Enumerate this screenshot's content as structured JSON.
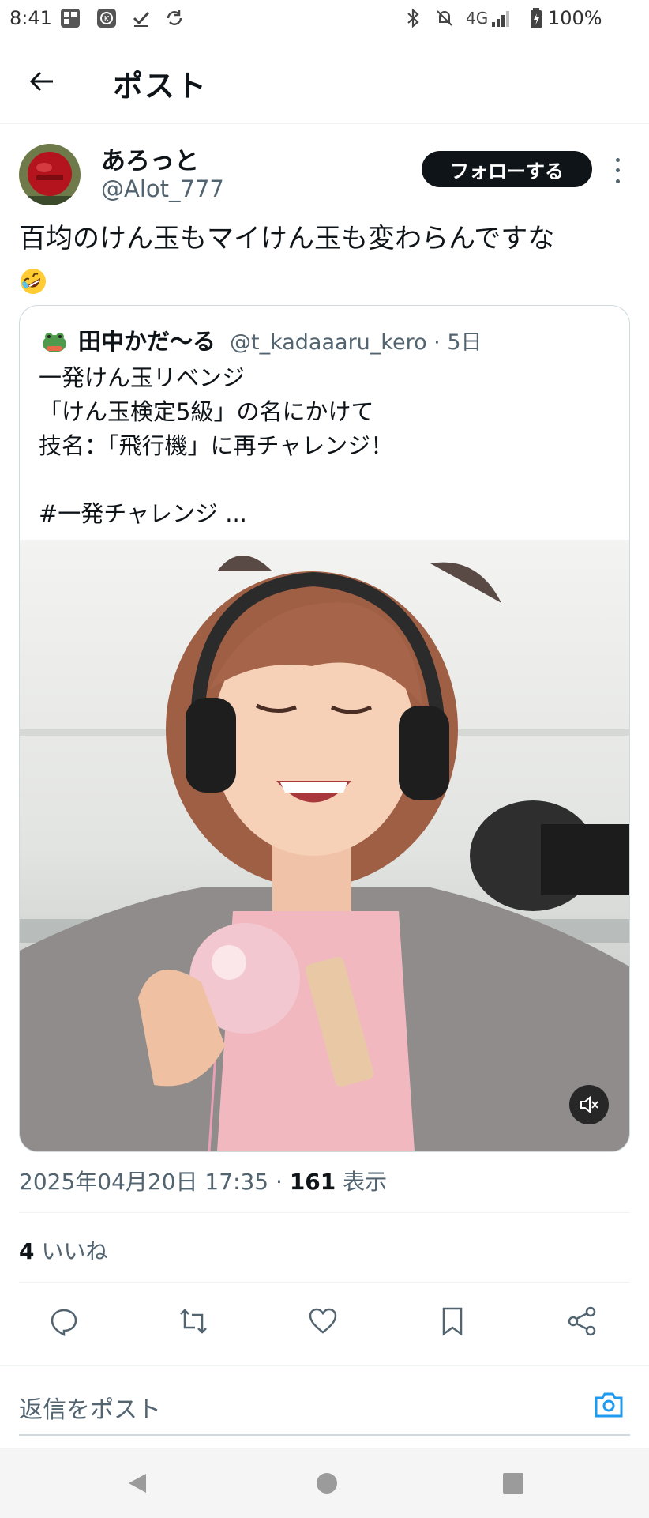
{
  "status_bar": {
    "time": "8:41",
    "network": "4G",
    "battery": "100%"
  },
  "header": {
    "title": "ポスト"
  },
  "post": {
    "author_name": "あろっと",
    "author_handle": "@Alot_777",
    "follow_label": "フォローする",
    "text": "百均のけん玉もマイけん玉も変わらんですな",
    "emoji": "rolling-on-floor-laughing-emoji",
    "timestamp": "2025年04月20日 17:35",
    "view_count": "161",
    "view_label": "表示",
    "like_count": "4",
    "like_label": "いいね"
  },
  "quote": {
    "author_name": "田中かだ〜る",
    "author_handle": "@t_kadaaaru_kero",
    "age": "5日",
    "lines": [
      "一発けん玉リベンジ",
      "「けん玉検定5級」の名にかけて",
      "技名：「飛行機」に再チャレンジ！",
      "",
      "#一発チャレンジ ..."
    ]
  },
  "reply": {
    "placeholder": "返信をポスト"
  },
  "colors": {
    "text": "#0f1419",
    "secondary": "#536471",
    "accent": "#1d9bf0",
    "border": "#cfd9de"
  },
  "icons": [
    "back-arrow-icon",
    "reply-icon",
    "repost-icon",
    "like-icon",
    "bookmark-icon",
    "share-icon",
    "camera-icon",
    "mute-icon",
    "more-icon"
  ]
}
